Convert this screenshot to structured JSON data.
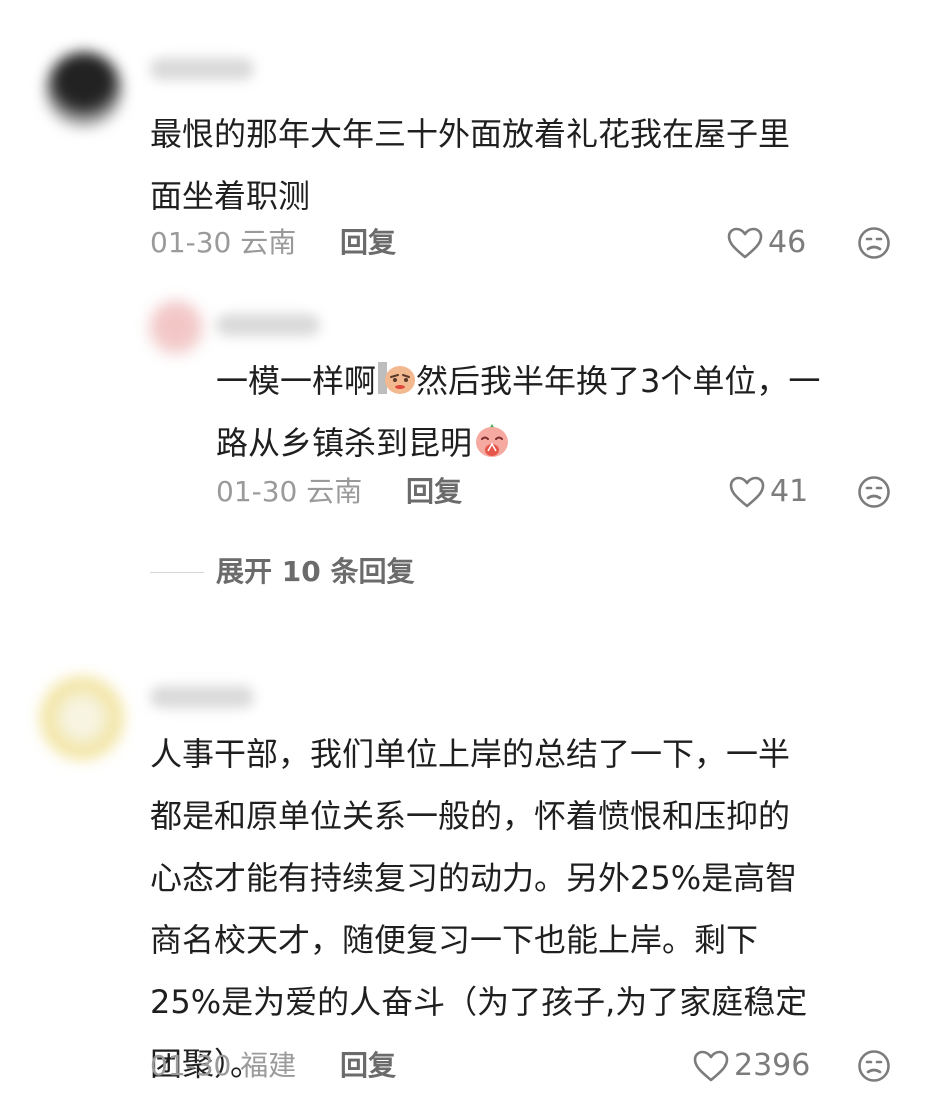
{
  "comments": [
    {
      "text_lines": [
        "最恨的那年大年三十外面放着礼花我在屋子里",
        "面坐着职测"
      ],
      "date": "01-30",
      "location": "云南",
      "reply_label": "回复",
      "likes": "46"
    },
    {
      "text_lines": [
        "人事干部，我们单位上岸的总结了一下，一半",
        "都是和原单位关系一般的，怀着愤恨和压抑的",
        "心态才能有持续复习的动力。另外25%是高智",
        "商名校天才，随便复习一下也能上岸。剩下",
        "25%是为爱的人奋斗（为了孩子,为了家庭稳定",
        "团聚）。"
      ],
      "date": "01-30",
      "location": "福建",
      "reply_label": "回复",
      "likes": "2396"
    }
  ],
  "reply": {
    "line1_a": "一模一样啊",
    "line1_b": "然后我半年换了3个单位，一",
    "line2": "路从乡镇杀到昆明",
    "date": "01-30",
    "location": "云南",
    "reply_label": "回复",
    "likes": "41",
    "emojis": [
      "smirk-emoji",
      "pray-emoji"
    ]
  },
  "expand_replies": "展开 10 条回复",
  "icons": {
    "like": "heart-outline-icon",
    "dislike": "frown-face-icon"
  }
}
